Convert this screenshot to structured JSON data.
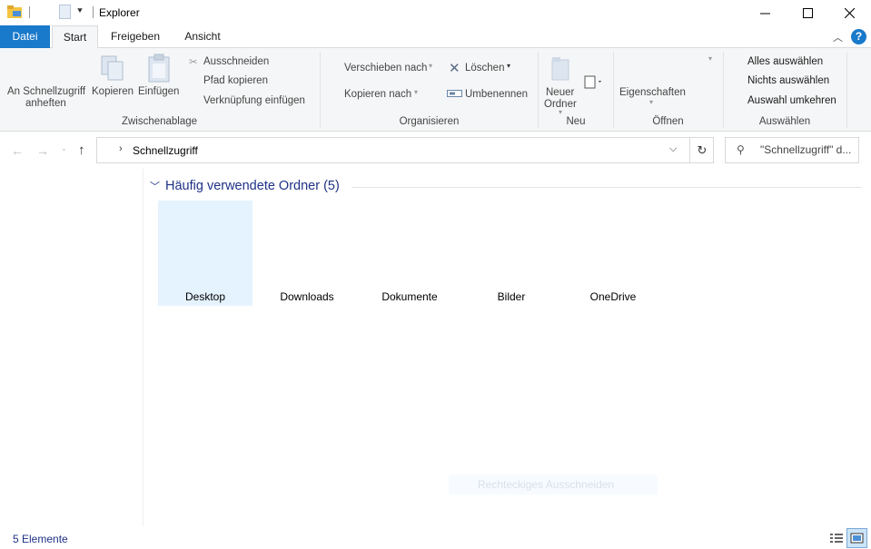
{
  "window": {
    "title": "Explorer",
    "controls": {
      "minimize": "—",
      "maximize": "☐",
      "close": "✕"
    }
  },
  "tabs": [
    {
      "label": "Datei"
    },
    {
      "label": "Start"
    },
    {
      "label": "Freigeben"
    },
    {
      "label": "Ansicht"
    }
  ],
  "ribbon": {
    "zwischenablage": {
      "label": "Zwischenablage",
      "pin_line1": "An Schnellzugriff",
      "pin_line2": "anheften",
      "copy": "Kopieren",
      "paste": "Einfügen",
      "cut": "Ausschneiden",
      "copy_path": "Pfad kopieren",
      "paste_shortcut": "Verknüpfung einfügen"
    },
    "organisieren": {
      "label": "Organisieren",
      "move_to": "Verschieben nach",
      "copy_to": "Kopieren nach",
      "delete": "Löschen",
      "rename": "Umbenennen"
    },
    "neu": {
      "label": "Neu",
      "new_folder_line1": "Neuer",
      "new_folder_line2": "Ordner"
    },
    "oeffnen": {
      "label": "Öffnen",
      "properties": "Eigenschaften"
    },
    "auswaehlen": {
      "label": "Auswählen",
      "select_all": "Alles auswählen",
      "select_none": "Nichts auswählen",
      "invert": "Auswahl umkehren"
    }
  },
  "address": {
    "path": "Schnellzugriff"
  },
  "search": {
    "placeholder": "\"Schnellzugriff\" d..."
  },
  "content": {
    "section_title": "Häufig verwendete Ordner (5)",
    "folders": [
      {
        "label": "Desktop",
        "selected": true
      },
      {
        "label": "Downloads",
        "selected": false
      },
      {
        "label": "Dokumente",
        "selected": false
      },
      {
        "label": "Bilder",
        "selected": false
      },
      {
        "label": "OneDrive",
        "selected": false
      }
    ],
    "ghost_tooltip": "Rechteckiges Ausschneiden"
  },
  "status": {
    "count": "5 Elemente"
  },
  "colors": {
    "accent": "#1979ca",
    "selection": "#e5f3ff",
    "header_blue": "#1e3287"
  }
}
